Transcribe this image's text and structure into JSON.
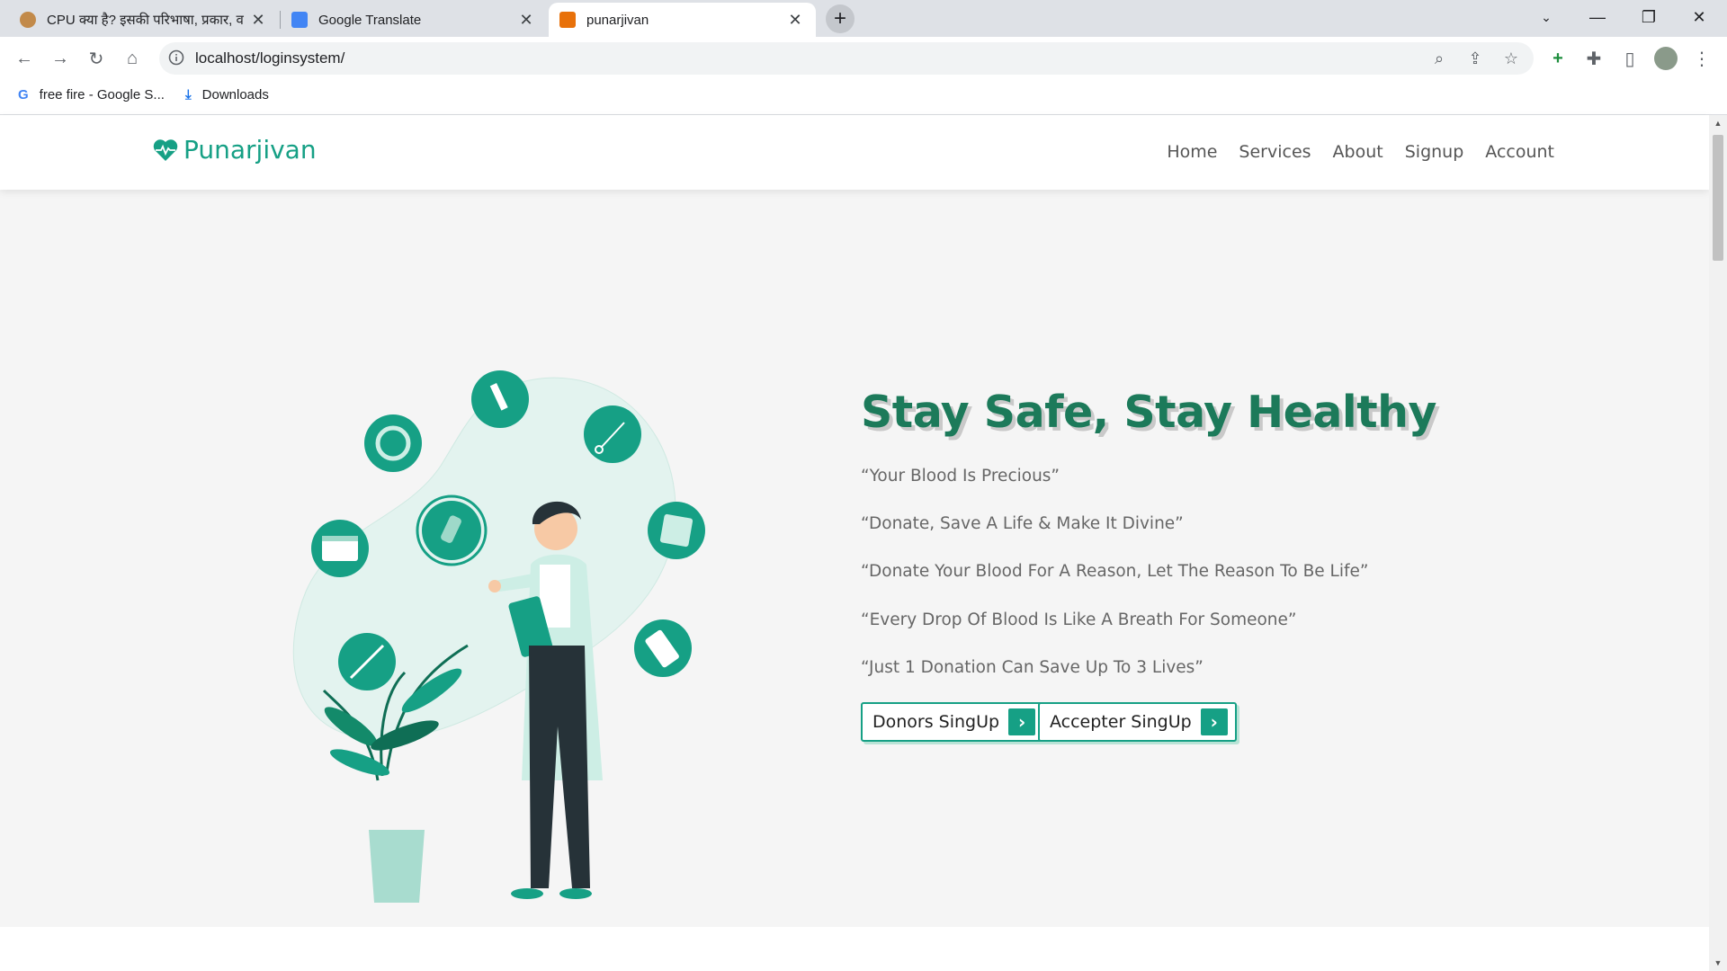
{
  "browser": {
    "tabs": [
      {
        "title": "CPU क्या है? इसकी परिभाषा, प्रकार, व",
        "active": false
      },
      {
        "title": "Google Translate",
        "active": false
      },
      {
        "title": "punarjivan",
        "active": true
      }
    ],
    "address": "localhost/loginsystem/",
    "bookmarks": [
      {
        "label": "free fire - Google S..."
      },
      {
        "label": "Downloads"
      }
    ]
  },
  "site": {
    "brand": "Punarjivan",
    "nav": [
      "Home",
      "Services",
      "About",
      "Signup",
      "Account"
    ],
    "hero_title": "Stay Safe, Stay Healthy",
    "quotes": [
      "“Your Blood Is Precious”",
      "“Donate, Save A Life & Make It Divine”",
      "“Donate Your Blood For A Reason, Let The Reason To Be Life”",
      "“Every Drop Of Blood Is Like A Breath For Someone”",
      "“Just 1 Donation Can Save Up To 3 Lives”"
    ],
    "buttons": {
      "donors": "Donors SingUp",
      "accepter": "Accepter SingUp"
    }
  },
  "colors": {
    "accent": "#16a085",
    "hero_title": "#1c7a5a",
    "blob": "#e3f3ef"
  }
}
